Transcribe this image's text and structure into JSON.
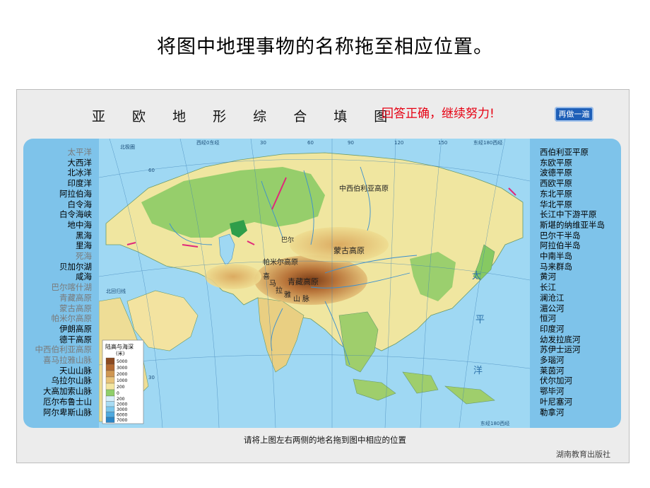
{
  "slide": {
    "title": "将图中地理事物的名称拖至相应位置。"
  },
  "panel": {
    "heading": "亚 欧 地 形 综 合 填 图",
    "feedback": "回答正确，继续努力!",
    "redo_label": "再做一遍",
    "instruction": "请将上图左右两侧的地名拖到图中相应的位置",
    "publisher": "湖南教育出版社"
  },
  "left_labels": [
    {
      "text": "太平洋",
      "color": "#7a7a7a"
    },
    {
      "text": "大西洋",
      "color": "#000000"
    },
    {
      "text": "北冰洋",
      "color": "#000000"
    },
    {
      "text": "印度洋",
      "color": "#000000"
    },
    {
      "text": "阿拉伯海",
      "color": "#000000"
    },
    {
      "text": "白令海",
      "color": "#000000"
    },
    {
      "text": "白令海峡",
      "color": "#000000"
    },
    {
      "text": "地中海",
      "color": "#000000"
    },
    {
      "text": "黑海",
      "color": "#000000"
    },
    {
      "text": "里海",
      "color": "#000000"
    },
    {
      "text": "死海",
      "color": "#7a7a7a"
    },
    {
      "text": "贝加尔湖",
      "color": "#000000"
    },
    {
      "text": "咸海",
      "color": "#000000"
    },
    {
      "text": "巴尔喀什湖",
      "color": "#7a7a7a"
    },
    {
      "text": "青藏高原",
      "color": "#7a7a7a"
    },
    {
      "text": "蒙古高原",
      "color": "#7a7a7a"
    },
    {
      "text": "帕米尔高原",
      "color": "#7a7a7a"
    },
    {
      "text": "伊朗高原",
      "color": "#000000"
    },
    {
      "text": "德干高原",
      "color": "#000000"
    },
    {
      "text": "中西伯利亚高原",
      "color": "#7a7a7a"
    },
    {
      "text": "喜马拉雅山脉",
      "color": "#7a7a7a"
    },
    {
      "text": "天山山脉",
      "color": "#000000"
    },
    {
      "text": "乌拉尔山脉",
      "color": "#000000"
    },
    {
      "text": "大高加索山脉",
      "color": "#000000"
    },
    {
      "text": "厄尔布鲁士山",
      "color": "#000000"
    },
    {
      "text": "阿尔卑斯山脉",
      "color": "#000000"
    }
  ],
  "right_labels": [
    "西伯利亚平原",
    "东欧平原",
    "波德平原",
    "西欧平原",
    "东北平原",
    "华北平原",
    "长江中下游平原",
    "斯堪的纳维亚半岛",
    "巴尔干半岛",
    "阿拉伯半岛",
    "中南半岛",
    "马来群岛",
    "黄河",
    "长江",
    "澜沧江",
    "湄公河",
    "恒河",
    "印度河",
    "幼发拉底河",
    "苏伊士运河",
    "多瑙河",
    "莱茵河",
    "伏尔加河",
    "鄂毕河",
    "叶尼塞河",
    "勒拿河"
  ],
  "map": {
    "placed_labels": [
      {
        "id": "central-siberian-plateau",
        "text": "中西伯利亚高原"
      },
      {
        "id": "mongolian-plateau",
        "text": "蒙古高原"
      },
      {
        "id": "pamir-plateau",
        "text": "帕米尔高原"
      },
      {
        "id": "tibetan-plateau",
        "text": "青藏高原"
      },
      {
        "id": "himalaya-1",
        "text": "喜"
      },
      {
        "id": "himalaya-2",
        "text": "马"
      },
      {
        "id": "himalaya-3",
        "text": "拉"
      },
      {
        "id": "himalaya-4",
        "text": "雅"
      },
      {
        "id": "himalaya-5",
        "text": "山"
      },
      {
        "id": "himalaya-6",
        "text": "脉"
      },
      {
        "id": "lake-balkhash-fragment",
        "text": "巴尔"
      }
    ],
    "ocean_labels": [
      {
        "id": "pacific-1",
        "text": "太"
      },
      {
        "id": "pacific-2",
        "text": "平"
      },
      {
        "id": "pacific-3",
        "text": "洋"
      }
    ],
    "graticule_labels": [
      {
        "id": "lon-west10-east0",
        "text": "西经0东经"
      },
      {
        "id": "lon-30",
        "text": "30"
      },
      {
        "id": "lon-60",
        "text": "60"
      },
      {
        "id": "lon-90",
        "text": "90"
      },
      {
        "id": "lon-120",
        "text": "120"
      },
      {
        "id": "lon-150",
        "text": "150"
      },
      {
        "id": "lon-180-top",
        "text": "东经180西经"
      },
      {
        "id": "lon-180-bottom",
        "text": "东经180西经"
      },
      {
        "id": "lat-30",
        "text": "30"
      },
      {
        "id": "lat-60",
        "text": "60"
      },
      {
        "id": "lat-tropic",
        "text": "北回归线"
      },
      {
        "id": "lat-arctic",
        "text": "北极圈"
      }
    ],
    "legend": {
      "title": "陆高与海深",
      "unit": "(米)",
      "land_levels": [
        "5000",
        "3000",
        "2000",
        "1000",
        "200",
        "0"
      ],
      "sea_levels": [
        "200",
        "2000",
        "3000",
        "6000",
        "7000"
      ],
      "land_colors": [
        "#8c4a21",
        "#b36a32",
        "#cf9752",
        "#e8c37a",
        "#f3e6a0",
        "#8fcf6b"
      ],
      "sea_colors": [
        "#d6effb",
        "#a8dcf4",
        "#7cc7ec",
        "#4faadf",
        "#2a86c6"
      ]
    }
  },
  "colors": {
    "feedback": "#e60012",
    "button": "#1e5fb8",
    "frame": "#7ec3ea",
    "sea": "#9fd8f3",
    "lowland": "#7dc25c",
    "highland": "#b8743a"
  }
}
